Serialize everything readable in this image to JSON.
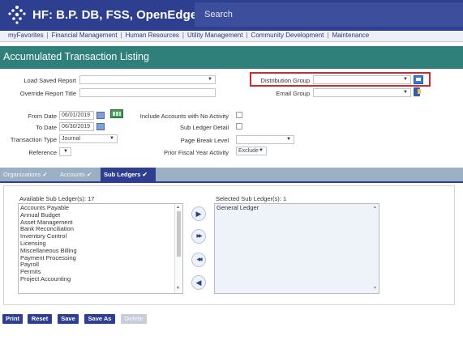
{
  "app": {
    "title": "HF: B.P. DB, FSS, OpenEdge, Hub",
    "search_placeholder": "Search"
  },
  "nav": [
    "myFavorites",
    "Financial Management",
    "Human Resources",
    "Utility Management",
    "Community Development",
    "Maintenance"
  ],
  "nav_separator": "|",
  "page": {
    "title": "Accumulated Transaction Listing"
  },
  "form": {
    "load_saved_report_label": "Load Saved Report",
    "load_saved_report_value": "",
    "override_title_label": "Override Report Title",
    "override_title_value": "",
    "distribution_group_label": "Distribution Group",
    "distribution_group_value": "",
    "email_group_label": "Email Group",
    "email_group_value": "",
    "from_date_label": "From Date",
    "from_date_value": "06/01/2019",
    "to_date_label": "To Date",
    "to_date_value": "06/30/2019",
    "transaction_type_label": "Transaction Type",
    "transaction_type_value": "Journal",
    "reference_label": "Reference",
    "reference_value": "",
    "include_no_activity_label": "Include Accounts with No Activity",
    "include_no_activity_checked": false,
    "sub_ledger_detail_label": "Sub Ledger Detail",
    "sub_ledger_detail_checked": false,
    "page_break_label": "Page Break Level",
    "page_break_value": "",
    "prior_fiscal_label": "Prior Fiscal Year Activity",
    "prior_fiscal_value": "Exclude"
  },
  "tabs": [
    {
      "label": "Organizations",
      "check": "✔",
      "active": false
    },
    {
      "label": "Accounts",
      "check": "✔",
      "active": false
    },
    {
      "label": "Sub Ledgers",
      "check": "✔",
      "active": true
    }
  ],
  "sub_ledgers": {
    "available_label": "Available Sub Ledger(s): 17",
    "available": [
      "Accounts Payable",
      "Annual Budget",
      "Asset Management",
      "Bank Reconciliation",
      "Inventory Control",
      "Licensing",
      "Miscellaneous Billing",
      "Payment Processing",
      "Payroll",
      "Permits",
      "Project Accounting"
    ],
    "selected_label": "Selected Sub Ledger(s): 1",
    "selected": [
      "General Ledger"
    ]
  },
  "move_buttons": [
    {
      "icon": "move-right-icon",
      "glyph": "▶"
    },
    {
      "icon": "move-all-right-icon",
      "glyph": "▶▶"
    },
    {
      "icon": "move-all-left-icon",
      "glyph": "◀◀"
    },
    {
      "icon": "move-left-icon",
      "glyph": "◀"
    }
  ],
  "buttons": {
    "print": "Print",
    "reset": "Reset",
    "save": "Save",
    "save_as": "Save As",
    "delete": "Delete"
  },
  "colors": {
    "brand": "#2e3f8f",
    "header_teal": "#2f7f7a",
    "highlight": "#d9262c"
  }
}
